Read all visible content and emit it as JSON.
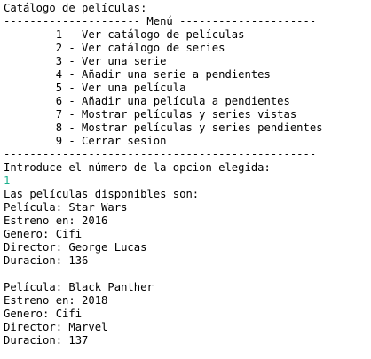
{
  "console": {
    "header": "Catálogo de películas:",
    "menu_title_line": "--------------------- Menú ---------------------",
    "menu_items": [
      "        1 - Ver catálogo de películas",
      "        2 - Ver catálogo de series",
      "        3 - Ver una serie",
      "        4 - Añadir una serie a pendientes",
      "        5 - Ver una película",
      "        6 - Añadir una película a pendientes",
      "        7 - Mostrar películas y series vistas",
      "        8 - Mostrar películas y series pendientes",
      "        9 - Cerrar sesion"
    ],
    "separator_line": "------------------------------------------------",
    "prompt": "Introduce el número de la opcion elegida:",
    "user_input": "1",
    "result_intro": "as películas disponibles son:",
    "result_intro_first_char": "L",
    "movies": [
      {
        "title_line": "Película: Star Wars",
        "release_line": "Estreno en: 2016",
        "genre_line": "Genero: Cifi",
        "director_line": "Director: George Lucas",
        "duration_line": "Duracion: 136"
      },
      {
        "title_line": "Película: Black Panther",
        "release_line": "Estreno en: 2018",
        "genre_line": "Genero: Cifi",
        "director_line": "Director: Marvel",
        "duration_line": "Duracion: 137"
      }
    ],
    "colors": {
      "text": "#000000",
      "input_echo": "#1bb08d",
      "background": "#ffffff"
    }
  }
}
